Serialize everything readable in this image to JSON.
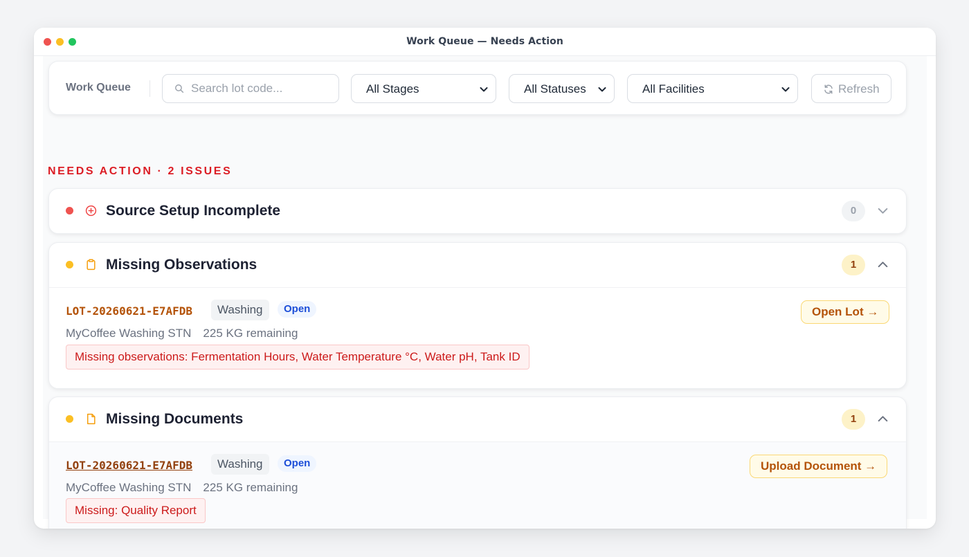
{
  "window": {
    "title": "Work Queue — Needs Action"
  },
  "toolbar": {
    "label": "Work Queue",
    "search_placeholder": "Search lot code...",
    "stage_filter": "All Stages",
    "status_filter": "All Statuses",
    "facility_filter": "All Facilities",
    "refresh_label": "Refresh"
  },
  "section": {
    "heading": "NEEDS ACTION · 2 ISSUES"
  },
  "groups": [
    {
      "title": "Source Setup Incomplete",
      "count": "0",
      "dot_color": "#ef5350",
      "icon": "plus-circle-icon",
      "expanded": false
    },
    {
      "title": "Missing Observations",
      "count": "1",
      "dot_color": "#fbbf24",
      "icon": "clipboard-icon",
      "expanded": true,
      "item": {
        "lot_code": "LOT-20260621-E7AFDB",
        "stage": "Washing",
        "status": "Open",
        "facility": "MyCoffee Washing STN",
        "remaining": "225 KG remaining",
        "issue": "Missing observations: Fermentation Hours, Water Temperature °C, Water pH, Tank ID",
        "action": "Open Lot →"
      }
    },
    {
      "title": "Missing Documents",
      "count": "1",
      "dot_color": "#fbbf24",
      "icon": "document-icon",
      "expanded": true,
      "item": {
        "lot_code": "LOT-20260621-E7AFDB",
        "stage": "Washing",
        "status": "Open",
        "facility": "MyCoffee Washing STN",
        "remaining": "225 KG remaining",
        "issue": "Missing: Quality Report",
        "action": "Upload Document →"
      }
    }
  ],
  "colors": {
    "accent_red": "#dc1c24",
    "accent_amber": "#b45309",
    "link_blue": "#1d4ed8"
  }
}
